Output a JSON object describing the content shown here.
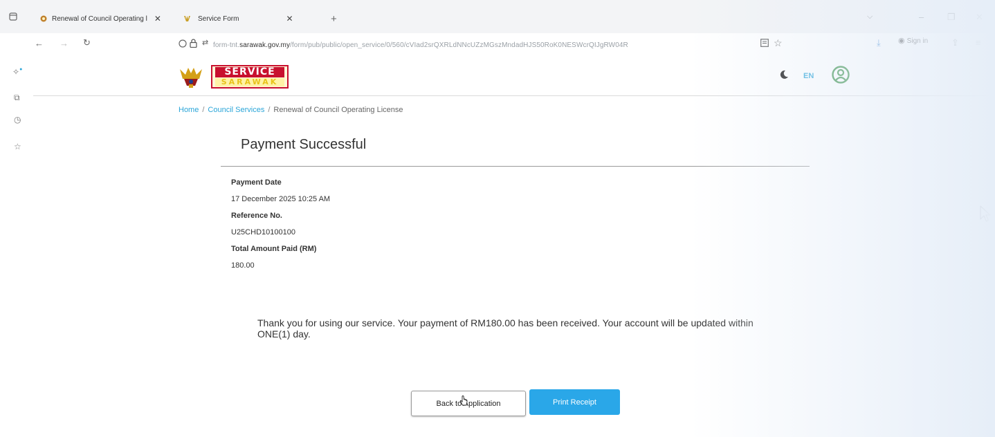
{
  "browser": {
    "tabs": [
      {
        "label": "Renewal of Council Operating l",
        "active": true
      },
      {
        "label": "Service Form",
        "active": false
      }
    ],
    "url_prefix": "form-tnt.",
    "url_domain": "sarawak.gov.my",
    "url_path": "/form/pub/public/open_service/0/560/cVIad2srQXRLdNNcUZzMGszMndadHJS50RoK0NESWcrQIJgRW04R",
    "sign_in_label": "Sign in"
  },
  "site": {
    "logo_top": "SERVICE",
    "logo_bottom": "SARAWAK",
    "language": "EN"
  },
  "breadcrumb": {
    "home": "Home",
    "sep": "/",
    "council": "Council Services",
    "current": "Renewal of Council Operating License"
  },
  "payment": {
    "title": "Payment Successful",
    "date_label": "Payment Date",
    "date_value": "17 December 2025 10:25 AM",
    "ref_label": "Reference No.",
    "ref_value": "U25CHD10100100",
    "amount_label": "Total Amount Paid (RM)",
    "amount_value": "180.00",
    "message": "Thank you for using our service. Your payment of RM180.00 has been received. Your account will be updated within ONE(1) day."
  },
  "actions": {
    "back_label": "Back to Application",
    "print_label": "Print Receipt"
  },
  "colors": {
    "accent": "#2aa7e8",
    "link": "#2aa5d8",
    "logo_red": "#c8102e",
    "logo_yellow": "#e8c21a"
  }
}
